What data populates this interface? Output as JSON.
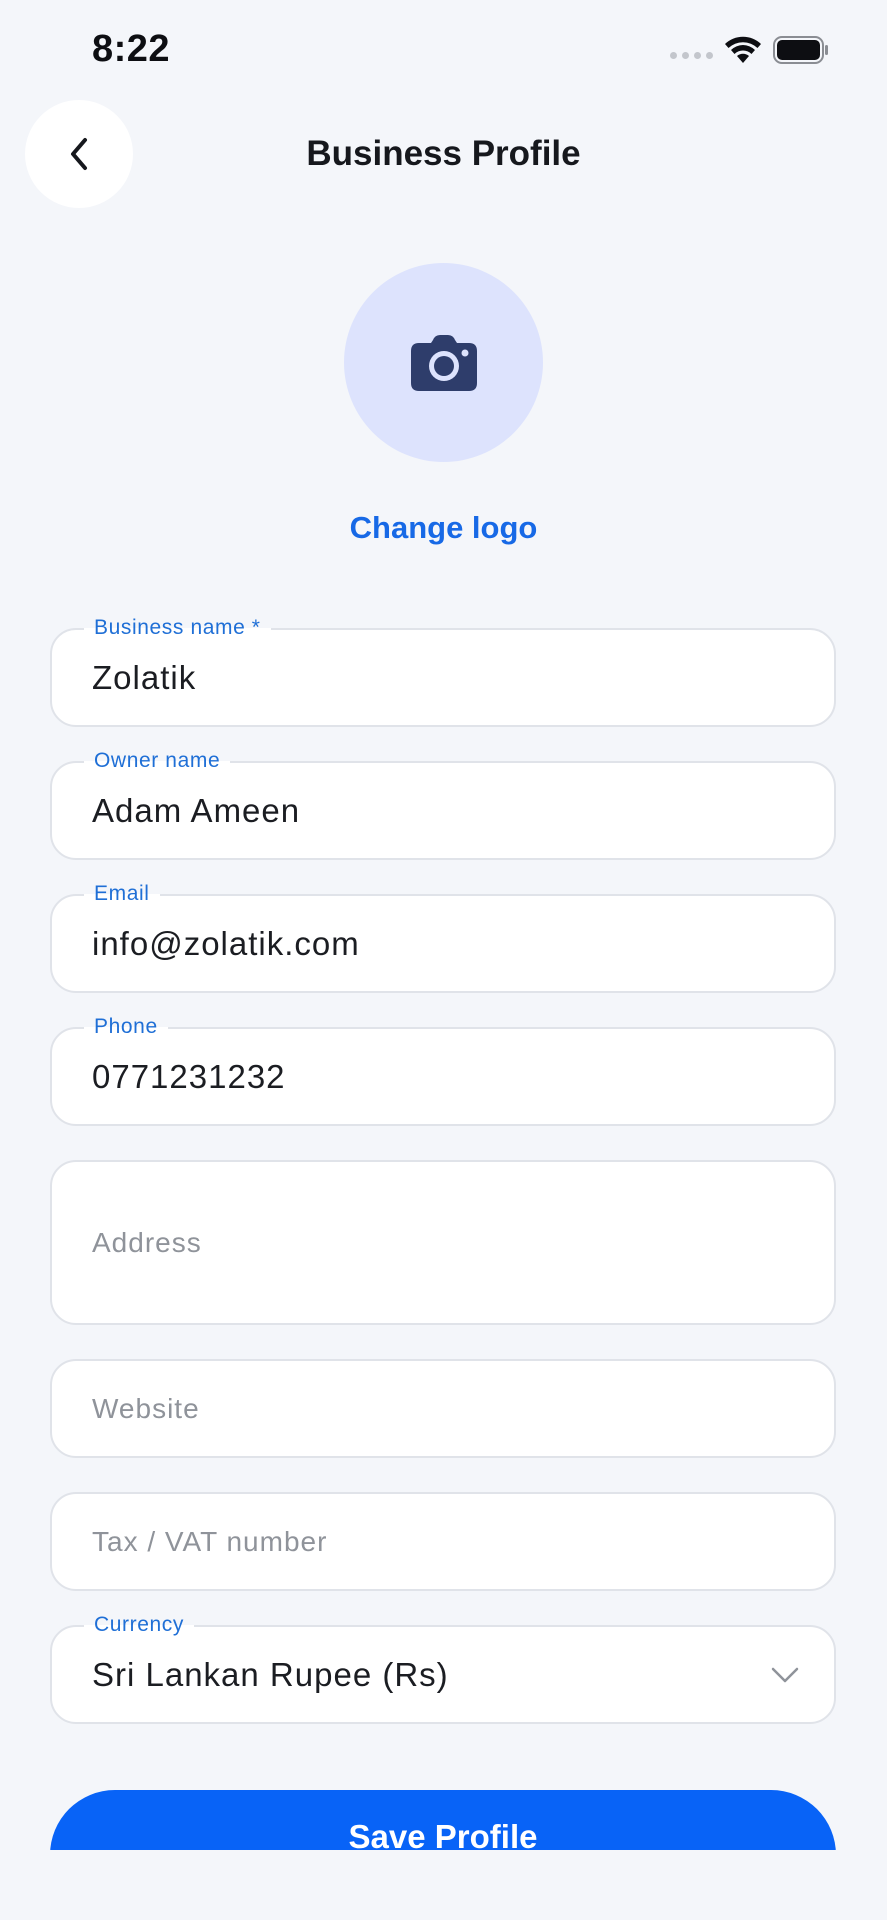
{
  "status_bar": {
    "time": "8:22"
  },
  "header": {
    "title": "Business Profile"
  },
  "logo": {
    "change_label": "Change logo"
  },
  "form": {
    "business_name": {
      "label": "Business name *",
      "value": "Zolatik"
    },
    "owner_name": {
      "label": "Owner name",
      "value": "Adam Ameen"
    },
    "email": {
      "label": "Email",
      "value": "info@zolatik.com"
    },
    "phone": {
      "label": "Phone",
      "value": "0771231232"
    },
    "address": {
      "placeholder": "Address"
    },
    "website": {
      "placeholder": "Website"
    },
    "tax_vat": {
      "placeholder": "Tax / VAT number"
    },
    "currency": {
      "label": "Currency",
      "value": "Sri Lankan Rupee (Rs)"
    }
  },
  "actions": {
    "save_label": "Save Profile"
  },
  "colors": {
    "accent": "#0863f7",
    "link": "#1769e6",
    "label": "#1f6fd6",
    "background": "#f4f6fa",
    "logo_bg": "#dde3fd",
    "camera_icon": "#2e3d6b"
  },
  "icons": {
    "back": "chevron-left-icon",
    "logo": "camera-icon",
    "currency_dropdown": "chevron-down-icon",
    "signal": "signal-dots-icon",
    "wifi": "wifi-icon",
    "battery": "battery-icon"
  }
}
